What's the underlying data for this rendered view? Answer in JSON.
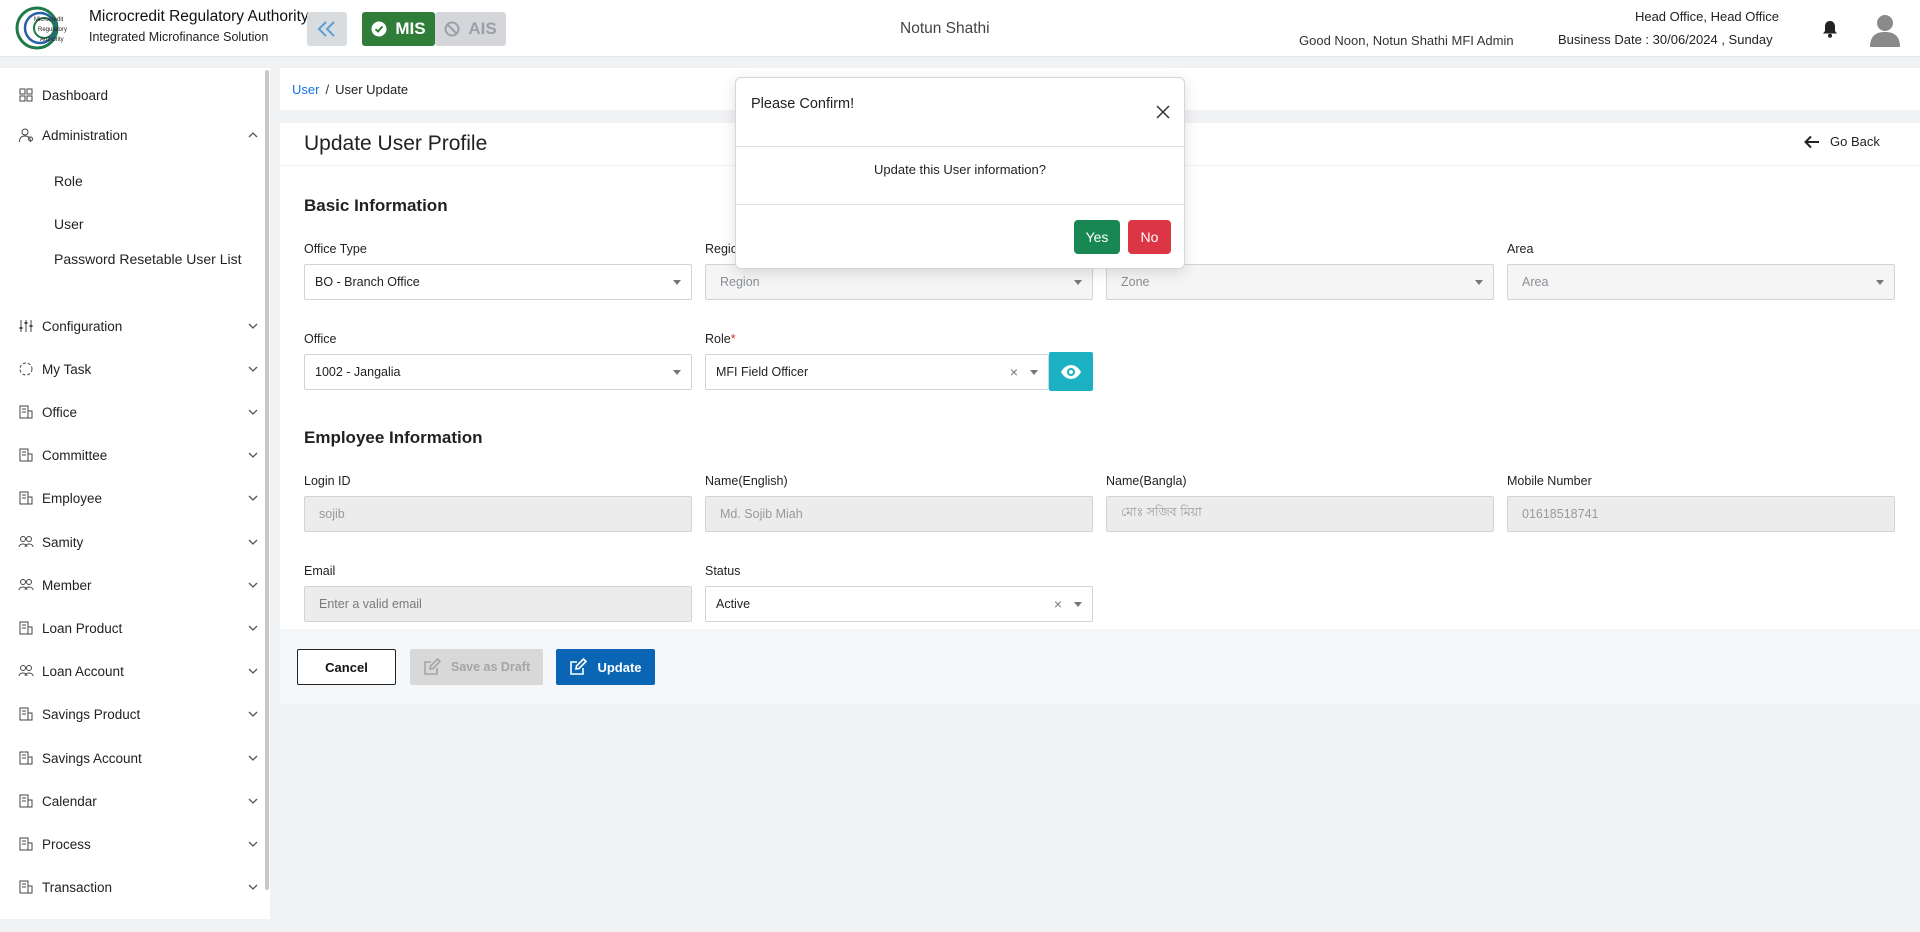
{
  "header": {
    "brand_title": "Microcredit Regulatory Authority",
    "brand_subtitle": "Integrated Microfinance Solution",
    "logo_text": "Microcredit Regulatory Authority",
    "modules": {
      "mis": "MIS",
      "ais": "AIS"
    },
    "org_name": "Notun Shathi",
    "greeting": "Good Noon, Notun Shathi MFI Admin",
    "office": "Head Office, Head Office",
    "business_date": "Business Date : 30/06/2024 , Sunday"
  },
  "sidebar": {
    "items": [
      {
        "label": "Dashboard"
      },
      {
        "label": "Administration"
      },
      {
        "label": "Configuration"
      },
      {
        "label": "My Task"
      },
      {
        "label": "Office"
      },
      {
        "label": "Committee"
      },
      {
        "label": "Employee"
      },
      {
        "label": "Samity"
      },
      {
        "label": "Member"
      },
      {
        "label": "Loan Product"
      },
      {
        "label": "Loan Account"
      },
      {
        "label": "Savings Product"
      },
      {
        "label": "Savings Account"
      },
      {
        "label": "Calendar"
      },
      {
        "label": "Process"
      },
      {
        "label": "Transaction"
      }
    ],
    "admin_sub": [
      {
        "label": "Role"
      },
      {
        "label": "User"
      },
      {
        "label": "Password Resetable User List"
      }
    ]
  },
  "breadcrumb": {
    "parent": "User",
    "separator": "/",
    "current": "User Update"
  },
  "page": {
    "title": "Update User Profile",
    "go_back": "Go Back"
  },
  "basic": {
    "title": "Basic Information",
    "office_type": {
      "label": "Office Type",
      "value": "BO - Branch Office"
    },
    "region": {
      "label": "Region",
      "placeholder": "Region"
    },
    "zone": {
      "placeholder": "Zone"
    },
    "area": {
      "label": "Area",
      "placeholder": "Area"
    },
    "office": {
      "label": "Office",
      "value": "1002 - Jangalia"
    },
    "role": {
      "label": "Role",
      "required": "*",
      "value": "MFI Field Officer"
    }
  },
  "employee": {
    "title": "Employee Information",
    "login_id": {
      "label": "Login ID",
      "value": "sojib"
    },
    "name_en": {
      "label": "Name(English)",
      "value": "Md. Sojib Miah"
    },
    "name_bn": {
      "label": "Name(Bangla)",
      "value": "মোঃ সজিব মিয়া"
    },
    "mobile": {
      "label": "Mobile Number",
      "value": "01618518741"
    },
    "email": {
      "label": "Email",
      "placeholder": "Enter a valid email"
    },
    "status": {
      "label": "Status",
      "value": "Active"
    }
  },
  "actions": {
    "cancel": "Cancel",
    "draft": "Save as Draft",
    "update": "Update"
  },
  "modal": {
    "title": "Please Confirm!",
    "message": "Update this User information?",
    "yes": "Yes",
    "no": "No"
  },
  "colors": {
    "mis_green": "#2f7d39",
    "update_blue": "#0b65b5",
    "eye_teal": "#1bb1c3",
    "yes_green": "#198754",
    "no_red": "#dc3545",
    "link_blue": "#1a73e8"
  },
  "icons": [
    "double-chevron-left-icon",
    "check-circle-icon",
    "ban-icon",
    "bell-icon",
    "user-avatar-icon",
    "arrow-left-icon",
    "eye-icon",
    "edit-icon",
    "close-icon",
    "chevron-down-icon",
    "chevron-up-icon"
  ]
}
